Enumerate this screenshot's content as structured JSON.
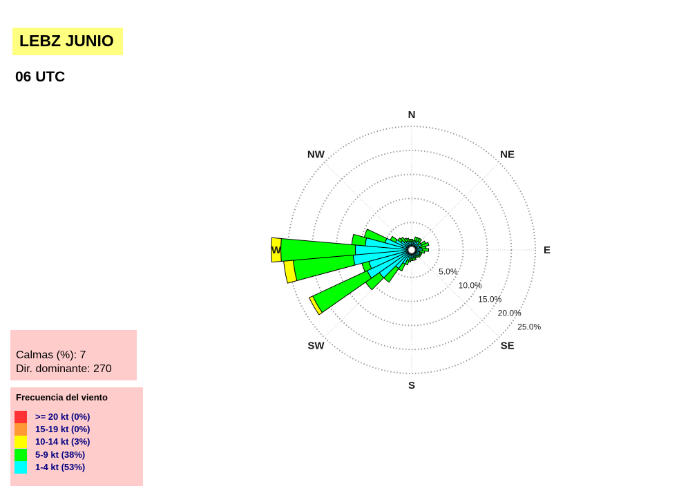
{
  "header": {
    "title": "LEBZ JUNIO",
    "subtitle": "06 UTC"
  },
  "stats": {
    "calms": "Calmas (%): 7",
    "dominant": "Dir. dominante:  270"
  },
  "legend": {
    "title": "Frecuencia del viento",
    "items": [
      {
        "label": ">= 20 kt (0%)",
        "color": "#ff3333"
      },
      {
        "label": "15-19 kt (0%)",
        "color": "#ff9933"
      },
      {
        "label": "10-14 kt (3%)",
        "color": "#ffff00"
      },
      {
        "label": "5-9 kt (38%)",
        "color": "#00ff00"
      },
      {
        "label": "1-4 kt (53%)",
        "color": "#00ffff"
      }
    ]
  },
  "chart_data": {
    "type": "windrose",
    "directions": [
      "N",
      "NE",
      "E",
      "SE",
      "S",
      "SW",
      "W",
      "NW"
    ],
    "ring_labels": [
      "5.0%",
      "10.0%",
      "15.0%",
      "20.0%",
      "25.0%"
    ],
    "rings": [
      5,
      10,
      15,
      20,
      25
    ],
    "rmax": 25,
    "sector_width_deg": 10,
    "bins": [
      "1-4 kt",
      "5-9 kt",
      "10-14 kt",
      "15-19 kt",
      ">= 20 kt"
    ],
    "bin_colors": [
      "#00ffff",
      "#00ff00",
      "#ffff00",
      "#ff9933",
      "#ff3333"
    ],
    "sectors": [
      {
        "dir": 0,
        "values": [
          1.0,
          0.5,
          0,
          0,
          0
        ]
      },
      {
        "dir": 10,
        "values": [
          1.0,
          0.3,
          0,
          0,
          0
        ]
      },
      {
        "dir": 20,
        "values": [
          1.3,
          0.8,
          0,
          0,
          0
        ]
      },
      {
        "dir": 30,
        "values": [
          1.2,
          0.9,
          0,
          0,
          0
        ]
      },
      {
        "dir": 40,
        "values": [
          1.5,
          0.7,
          0,
          0,
          0
        ]
      },
      {
        "dir": 50,
        "values": [
          1.0,
          0.6,
          0,
          0,
          0
        ]
      },
      {
        "dir": 60,
        "values": [
          1.5,
          1.0,
          0,
          0,
          0
        ]
      },
      {
        "dir": 70,
        "values": [
          1.0,
          2.0,
          0,
          0,
          0
        ]
      },
      {
        "dir": 80,
        "values": [
          1.3,
          1.0,
          0,
          0,
          0
        ]
      },
      {
        "dir": 90,
        "values": [
          1.5,
          1.3,
          0,
          0,
          0
        ]
      },
      {
        "dir": 100,
        "values": [
          1.0,
          1.0,
          0,
          0,
          0
        ]
      },
      {
        "dir": 110,
        "values": [
          1.0,
          0.5,
          0,
          0,
          0
        ]
      },
      {
        "dir": 120,
        "values": [
          1.2,
          0.3,
          0,
          0,
          0
        ]
      },
      {
        "dir": 130,
        "values": [
          1.0,
          0.5,
          0,
          0,
          0
        ]
      },
      {
        "dir": 140,
        "values": [
          0.8,
          0.4,
          0,
          0,
          0
        ]
      },
      {
        "dir": 150,
        "values": [
          0.8,
          0.3,
          0,
          0,
          0
        ]
      },
      {
        "dir": 160,
        "values": [
          1.0,
          0.5,
          0,
          0,
          0
        ]
      },
      {
        "dir": 170,
        "values": [
          1.0,
          0.5,
          0,
          0,
          0
        ]
      },
      {
        "dir": 180,
        "values": [
          1.0,
          0.5,
          0,
          0,
          0
        ]
      },
      {
        "dir": 190,
        "values": [
          1.0,
          0.8,
          0,
          0,
          0
        ]
      },
      {
        "dir": 200,
        "values": [
          1.5,
          1.0,
          0,
          0,
          0
        ]
      },
      {
        "dir": 210,
        "values": [
          2.5,
          1.6,
          0,
          0,
          0
        ]
      },
      {
        "dir": 220,
        "values": [
          4.0,
          3.5,
          0,
          0,
          0
        ]
      },
      {
        "dir": 230,
        "values": [
          7.5,
          3.5,
          0,
          0,
          0
        ]
      },
      {
        "dir": 240,
        "values": [
          9.5,
          12.5,
          0.8,
          0,
          0
        ]
      },
      {
        "dir": 250,
        "values": [
          8.5,
          1.5,
          0,
          0,
          0
        ]
      },
      {
        "dir": 260,
        "values": [
          11.5,
          12.5,
          2.0,
          0,
          0
        ]
      },
      {
        "dir": 270,
        "values": [
          11.0,
          15.5,
          2.0,
          0,
          0
        ]
      },
      {
        "dir": 280,
        "values": [
          9.0,
          2.8,
          0,
          0,
          0
        ]
      },
      {
        "dir": 290,
        "values": [
          5.0,
          4.5,
          0,
          0,
          0
        ]
      },
      {
        "dir": 300,
        "values": [
          3.0,
          1.2,
          0,
          0,
          0
        ]
      },
      {
        "dir": 310,
        "values": [
          2.0,
          0.8,
          0,
          0,
          0
        ]
      },
      {
        "dir": 320,
        "values": [
          1.5,
          1.0,
          0,
          0,
          0
        ]
      },
      {
        "dir": 330,
        "values": [
          1.3,
          0.7,
          0,
          0,
          0
        ]
      },
      {
        "dir": 340,
        "values": [
          1.2,
          0.6,
          0,
          0,
          0
        ]
      },
      {
        "dir": 350,
        "values": [
          1.0,
          0.5,
          0,
          0,
          0
        ]
      }
    ]
  }
}
